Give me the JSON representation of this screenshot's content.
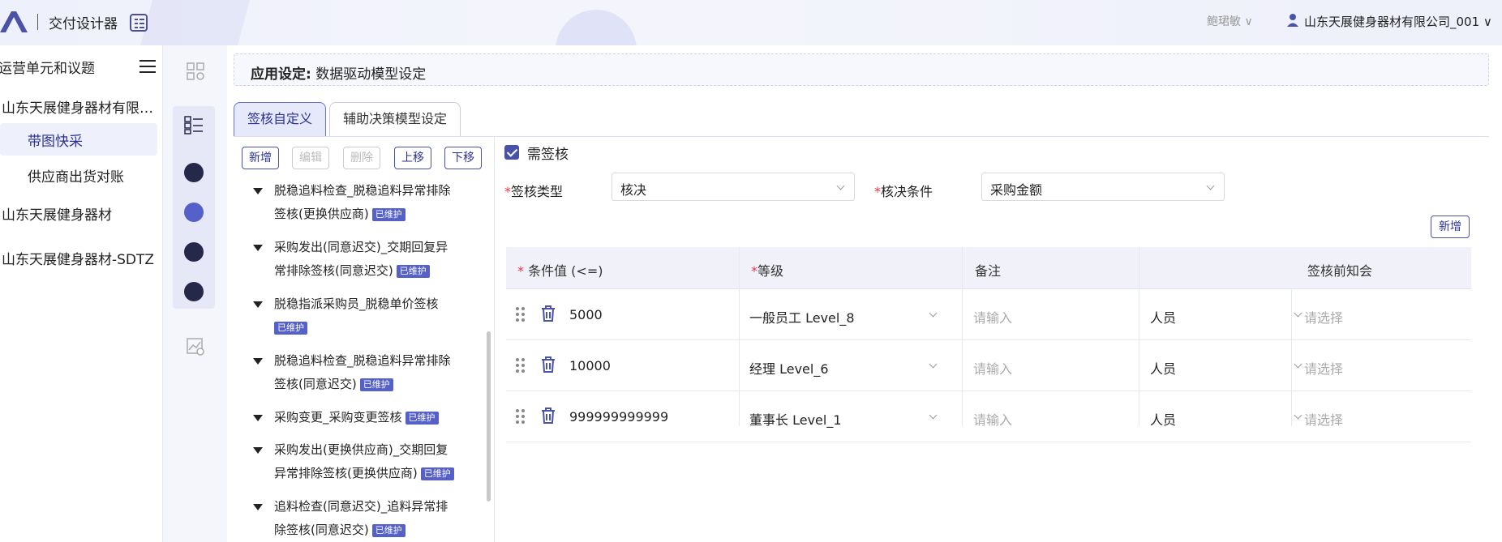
{
  "header": {
    "app_title": "交付设计器",
    "user_name": "鲍珺敏",
    "company": "山东天展健身器材有限公司_001"
  },
  "leftnav": {
    "title": "运营单元和议题",
    "items": [
      {
        "label": "山东天展健身器材有限…",
        "level": 0
      },
      {
        "label": "带图快采",
        "level": 1,
        "selected": true
      },
      {
        "label": "供应商出货对账",
        "level": 1
      },
      {
        "label": "山东天展健身器材",
        "level": 0
      },
      {
        "label": "山东天展健身器材-SDTZ",
        "level": 0
      }
    ]
  },
  "breadcrumb": {
    "prefix": "应用设定:",
    "title": "数据驱动模型设定"
  },
  "tabs": [
    {
      "label": "签核自定义",
      "active": true
    },
    {
      "label": "辅助决策模型设定",
      "active": false
    }
  ],
  "tree": {
    "buttons": {
      "add": "新增",
      "edit": "编辑",
      "delete": "删除",
      "up": "上移",
      "down": "下移"
    },
    "badge": "已维护",
    "items": [
      {
        "line1": "脱稳追料检查_脱稳追料异常排除",
        "line2": "签核(更换供应商)"
      },
      {
        "line1": "采购发出(同意迟交)_交期回复异",
        "line2": "常排除签核(同意迟交)"
      },
      {
        "line1": "脱稳指派采购员_脱稳单价签核",
        "line2": ""
      },
      {
        "line1": "脱稳追料检查_脱稳追料异常排除",
        "line2": "签核(同意迟交)"
      },
      {
        "line1": "采购变更_采购变更签核",
        "line2": null
      },
      {
        "line1": "采购发出(更换供应商)_交期回复",
        "line2": "异常排除签核(更换供应商)"
      },
      {
        "line1": "追料检查(同意迟交)_追料异常排",
        "line2": "除签核(同意迟交)"
      }
    ]
  },
  "form": {
    "need_sign": "需签核",
    "sign_type_label": "签核类型",
    "sign_type_value": "核决",
    "condition_label": "核决条件",
    "condition_value": "采购金额",
    "add_label": "新增"
  },
  "table": {
    "headers": {
      "condition": "条件值 (<=)",
      "level": "等级",
      "remark": "备注",
      "notice": "签核前知会"
    },
    "rows": [
      {
        "value": "5000",
        "level": "一般员工 Level_8",
        "remark_placeholder": "请输入",
        "notice_type": "人员",
        "notice_placeholder": "请选择"
      },
      {
        "value": "10000",
        "level": "经理 Level_6",
        "remark_placeholder": "请输入",
        "notice_type": "人员",
        "notice_placeholder": "请选择"
      },
      {
        "value": "999999999999",
        "level": "董事长 Level_1",
        "remark_placeholder": "请输入",
        "notice_type": "人员",
        "notice_placeholder": "请选择"
      }
    ]
  },
  "colors": {
    "accent": "#4a52a8",
    "badge": "#5560c8",
    "required": "#e34"
  }
}
